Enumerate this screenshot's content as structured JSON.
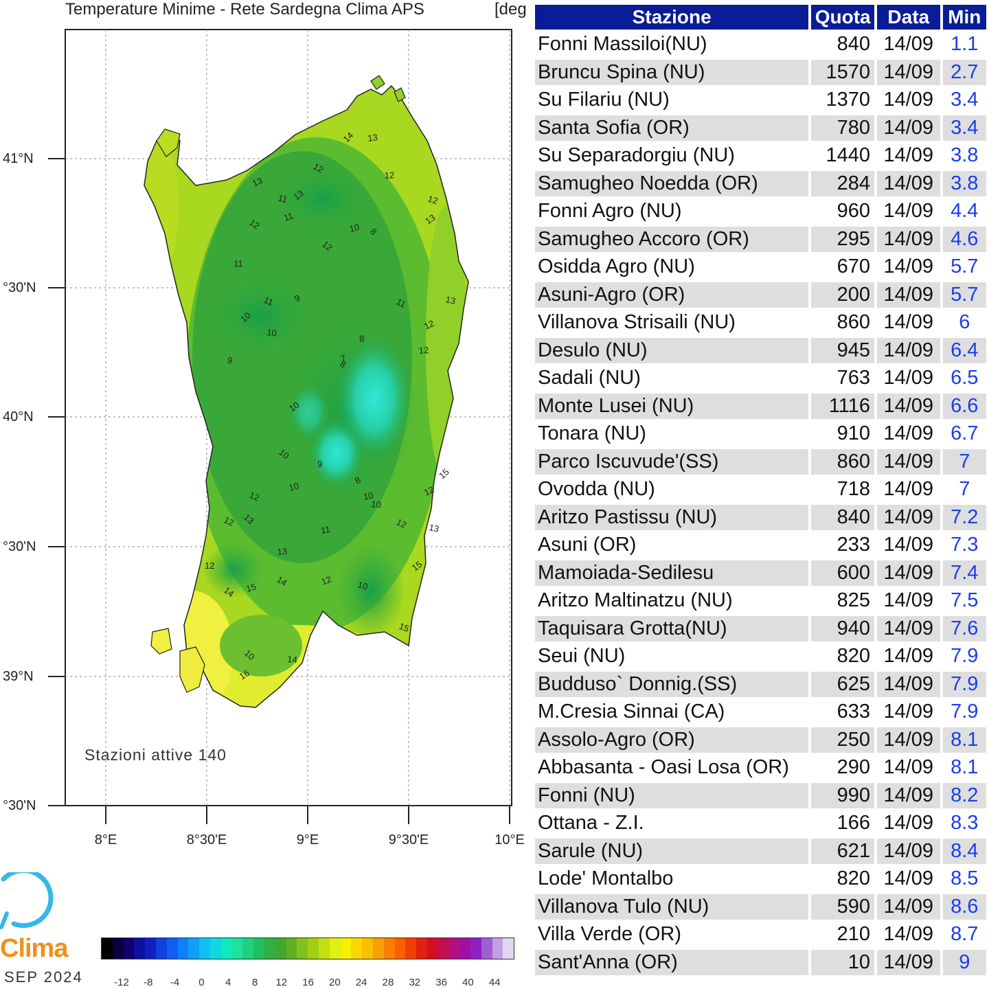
{
  "map": {
    "title": "Temperature Minime - Rete Sardegna Clima APS",
    "unit": "[deg",
    "lat_labels": [
      "41°N",
      "°30'N",
      "40°N",
      "°30'N",
      "39°N",
      "°30'N"
    ],
    "lon_labels": [
      "8°E",
      "8°30'E",
      "9°E",
      "9°30'E",
      "10°E"
    ],
    "stations_note": "Stazioni  attive  140",
    "contour_labels": [
      "14",
      "13",
      "12",
      "13",
      "11",
      "13",
      "12",
      "12",
      "11",
      "12",
      "13",
      "11",
      "12",
      "10",
      "11",
      "9",
      "10",
      "8",
      "8",
      "11",
      "12",
      "13",
      "10",
      "12",
      "8",
      "7",
      "9",
      "10",
      "9",
      "10",
      "10",
      "12",
      "8",
      "10",
      "13",
      "11",
      "12",
      "12",
      "13",
      "15",
      "13",
      "14",
      "12",
      "10",
      "15",
      "12",
      "14",
      "15",
      "15",
      "16",
      "14",
      "10",
      "10",
      "12"
    ],
    "colorbar_colors": [
      "#000000",
      "#0a0040",
      "#100070",
      "#1010a0",
      "#1020c0",
      "#1040e0",
      "#1060f0",
      "#1080f8",
      "#10a0f8",
      "#10c0f0",
      "#10d8e0",
      "#10e8c0",
      "#20e0a0",
      "#20d080",
      "#20c060",
      "#30b040",
      "#40a830",
      "#60b020",
      "#80c020",
      "#a0d010",
      "#c0e010",
      "#e0f010",
      "#f8f000",
      "#f8d800",
      "#f8c000",
      "#f8a000",
      "#f88000",
      "#f86000",
      "#f04000",
      "#e02010",
      "#d01020",
      "#c01050",
      "#b01080",
      "#a010a0",
      "#9020c0",
      "#a060d0",
      "#c0a0e0",
      "#e0d8f0"
    ],
    "colorbar_ticks": [
      "-12",
      "-8",
      "-4",
      "0",
      "4",
      "8",
      "12",
      "16",
      "20",
      "24",
      "28",
      "32",
      "36",
      "40",
      "44"
    ]
  },
  "brand": {
    "name": "Clima",
    "date": "SEP  2024"
  },
  "table": {
    "headers": {
      "station": "Stazione",
      "quota": "Quota",
      "data": "Data",
      "min": "Min"
    },
    "rows": [
      {
        "station": "Fonni Massiloi(NU)",
        "quota": "840",
        "data": "14/09",
        "min": "1.1"
      },
      {
        "station": "Bruncu Spina (NU)",
        "quota": "1570",
        "data": "14/09",
        "min": "2.7"
      },
      {
        "station": "Su Filariu (NU)",
        "quota": "1370",
        "data": "14/09",
        "min": "3.4"
      },
      {
        "station": "Santa Sofia (OR)",
        "quota": "780",
        "data": "14/09",
        "min": "3.4"
      },
      {
        "station": "Su Separadorgiu (NU)",
        "quota": "1440",
        "data": "14/09",
        "min": "3.8"
      },
      {
        "station": "Samugheo Noedda (OR)",
        "quota": "284",
        "data": "14/09",
        "min": "3.8"
      },
      {
        "station": "Fonni Agro (NU)",
        "quota": "960",
        "data": "14/09",
        "min": "4.4"
      },
      {
        "station": "Samugheo Accoro (OR)",
        "quota": "295",
        "data": "14/09",
        "min": "4.6"
      },
      {
        "station": "Osidda Agro (NU)",
        "quota": "670",
        "data": "14/09",
        "min": "5.7"
      },
      {
        "station": "Asuni-Agro (OR)",
        "quota": "200",
        "data": "14/09",
        "min": "5.7"
      },
      {
        "station": "Villanova Strisaili (NU)",
        "quota": "860",
        "data": "14/09",
        "min": "6"
      },
      {
        "station": "Desulo (NU)",
        "quota": "945",
        "data": "14/09",
        "min": "6.4"
      },
      {
        "station": "Sadali (NU)",
        "quota": "763",
        "data": "14/09",
        "min": "6.5"
      },
      {
        "station": "Monte Lusei (NU)",
        "quota": "1116",
        "data": "14/09",
        "min": "6.6"
      },
      {
        "station": "Tonara (NU)",
        "quota": "910",
        "data": "14/09",
        "min": "6.7"
      },
      {
        "station": "Parco Iscuvude'(SS)",
        "quota": "860",
        "data": "14/09",
        "min": "7"
      },
      {
        "station": "Ovodda (NU)",
        "quota": "718",
        "data": "14/09",
        "min": "7"
      },
      {
        "station": "Aritzo Pastissu (NU)",
        "quota": "840",
        "data": "14/09",
        "min": "7.2"
      },
      {
        "station": "Asuni (OR)",
        "quota": "233",
        "data": "14/09",
        "min": "7.3"
      },
      {
        "station": "Mamoiada-Sedilesu",
        "quota": "600",
        "data": "14/09",
        "min": "7.4"
      },
      {
        "station": "Aritzo Maltinatzu (NU)",
        "quota": "825",
        "data": "14/09",
        "min": "7.5"
      },
      {
        "station": "Taquisara Grotta(NU)",
        "quota": "940",
        "data": "14/09",
        "min": "7.6"
      },
      {
        "station": "Seui (NU)",
        "quota": "820",
        "data": "14/09",
        "min": "7.9"
      },
      {
        "station": "Budduso` Donnig.(SS)",
        "quota": "625",
        "data": "14/09",
        "min": "7.9"
      },
      {
        "station": "M.Cresia Sinnai (CA)",
        "quota": "633",
        "data": "14/09",
        "min": "7.9"
      },
      {
        "station": "Assolo-Agro (OR)",
        "quota": "250",
        "data": "14/09",
        "min": "8.1"
      },
      {
        "station": "Abbasanta - Oasi Losa (OR)",
        "quota": "290",
        "data": "14/09",
        "min": "8.1"
      },
      {
        "station": "Fonni (NU)",
        "quota": "990",
        "data": "14/09",
        "min": "8.2"
      },
      {
        "station": "Ottana - Z.I.",
        "quota": "166",
        "data": "14/09",
        "min": "8.3"
      },
      {
        "station": "Sarule (NU)",
        "quota": "621",
        "data": "14/09",
        "min": "8.4"
      },
      {
        "station": "Lode' Montalbo",
        "quota": "820",
        "data": "14/09",
        "min": "8.5"
      },
      {
        "station": "Villanova Tulo (NU)",
        "quota": "590",
        "data": "14/09",
        "min": "8.6"
      },
      {
        "station": "Villa Verde (OR)",
        "quota": "210",
        "data": "14/09",
        "min": "8.7"
      },
      {
        "station": "Sant'Anna (OR)",
        "quota": "10",
        "data": "14/09",
        "min": "9"
      }
    ]
  }
}
